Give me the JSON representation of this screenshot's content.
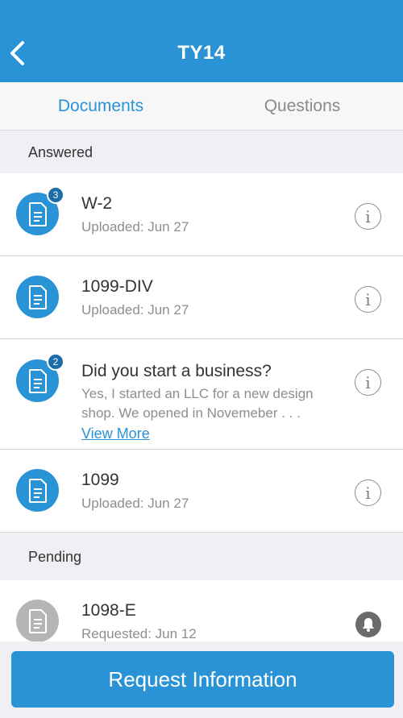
{
  "header": {
    "title": "TY14",
    "back_icon": "chevron-left-icon"
  },
  "tabs": [
    {
      "label": "Documents",
      "active": true
    },
    {
      "label": "Questions",
      "active": false
    }
  ],
  "sections": {
    "answered": "Answered",
    "pending": "Pending"
  },
  "rows": [
    {
      "title": "W-2",
      "subtitle": "Uploaded: Jun 27",
      "badge": "3",
      "icon": "document-icon",
      "action_icon": "info-icon"
    },
    {
      "title": "1099-DIV",
      "subtitle": "Uploaded: Jun 27",
      "icon": "document-icon",
      "action_icon": "info-icon"
    },
    {
      "title": "Did you start a business?",
      "description": "Yes, I started an LLC for a new design shop. We opened in Novemeber . . .",
      "link": "View More ",
      "badge": "2",
      "icon": "document-icon",
      "action_icon": "info-icon"
    },
    {
      "title": "1099",
      "subtitle": "Uploaded: Jun 27",
      "icon": "document-icon",
      "action_icon": "info-icon"
    },
    {
      "title": "1098-E",
      "subtitle": "Requested: Jun 12",
      "icon": "document-icon",
      "action_icon": "bell-icon"
    }
  ],
  "info_glyph": "i",
  "bottom": {
    "button_label": "Request Information"
  },
  "colors": {
    "accent": "#2a93d5",
    "badge": "#1d6da8",
    "pending_icon": "#b5b5b5"
  }
}
